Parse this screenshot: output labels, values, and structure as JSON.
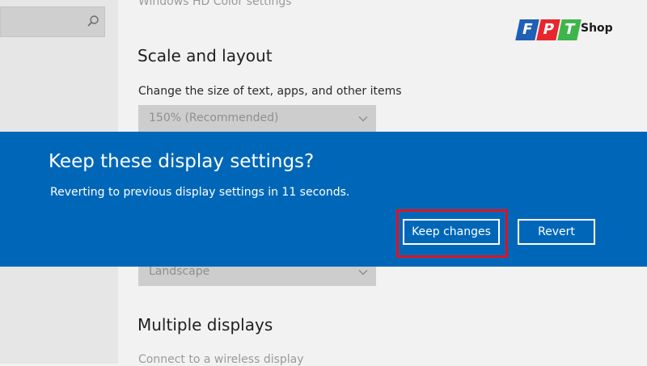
{
  "settings": {
    "hd_color_link": "Windows HD Color settings",
    "scale_title": "Scale and layout",
    "scale_label": "Change the size of text, apps, and other items",
    "scale_value": "150% (Recommended)",
    "orientation_value": "Landscape",
    "multiple_title": "Multiple displays",
    "wireless_link": "Connect to a wireless display"
  },
  "dialog": {
    "title": "Keep these display settings?",
    "message": "Reverting to previous display settings in 11 seconds.",
    "keep_label": "Keep changes",
    "revert_label": "Revert"
  },
  "logo": {
    "letters": [
      "F",
      "P",
      "T"
    ],
    "suffix": "Shop",
    "colors": [
      "#1f5fb6",
      "#e7262e",
      "#3db54a"
    ]
  },
  "colors": {
    "dialog_bg": "#0067b8",
    "highlight": "#e0121f"
  }
}
